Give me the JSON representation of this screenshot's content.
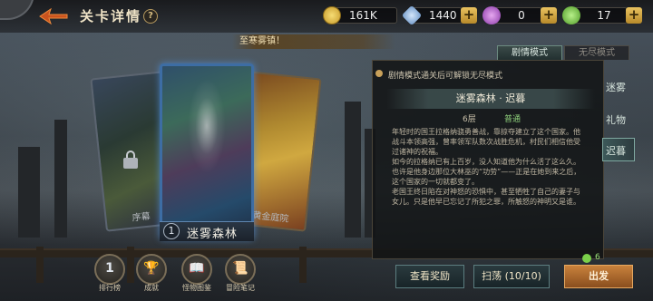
{
  "header": {
    "title": "关卡详情",
    "help_icon": "?"
  },
  "resources": [
    {
      "name": "gold",
      "value": "161K",
      "color": "#e8c04a",
      "has_plus": false
    },
    {
      "name": "diamond",
      "value": "1440",
      "color": "#8fb8e8",
      "has_plus": true
    },
    {
      "name": "rune",
      "value": "0",
      "color": "#c070d8",
      "has_plus": true
    },
    {
      "name": "stamina",
      "value": "17",
      "color": "#7bd04a",
      "has_plus": true
    }
  ],
  "banner": "至寒雾镇！",
  "cards": {
    "left_label": "序幕",
    "right_label": "黄金庭院",
    "main_number": "1",
    "main_name": "迷雾森林"
  },
  "panel": {
    "tab_story": "剧情模式",
    "tab_endless": "无尽模式",
    "unlock_tip": "剧情模式通关后可解锁无尽模式",
    "level_title": "迷雾森林 · 迟暮",
    "floor": "6层",
    "difficulty": "普通",
    "story": [
      "年轻时的国王拉格纳骁勇善战，靠掠夺建立了这个国家。他",
      "战斗本领高强，曾率领军队数次战胜危机，村民们相信他受",
      "过诸神的祝福。",
      "如今的拉格纳已有上百岁，没人知道他为什么活了这么久。",
      "也许是他身边那位大林巫的“功劳”——正是在她到来之后，",
      "这个国家的一切就都变了。",
      "老国王终日陷在对神怒的恐惧中，甚至牺牲了自己的妻子与",
      "女儿。只是他早已忘记了所犯之罪，所触怒的神明又是谁。"
    ]
  },
  "side_options": [
    "迷雾",
    "礼物",
    "迟暮"
  ],
  "bottom_nav": [
    {
      "label": "排行榜",
      "icon": "rank-icon",
      "glyph": "1"
    },
    {
      "label": "成就",
      "icon": "trophy-icon",
      "glyph": "🏆"
    },
    {
      "label": "怪物图鉴",
      "icon": "book-icon",
      "glyph": "📖"
    },
    {
      "label": "冒险笔记",
      "icon": "scroll-icon",
      "glyph": "📜"
    }
  ],
  "actions": {
    "view_rewards": "查看奖励",
    "sweep": "扫荡 (10/10)",
    "depart": "出发",
    "stamina_cost": "6"
  }
}
